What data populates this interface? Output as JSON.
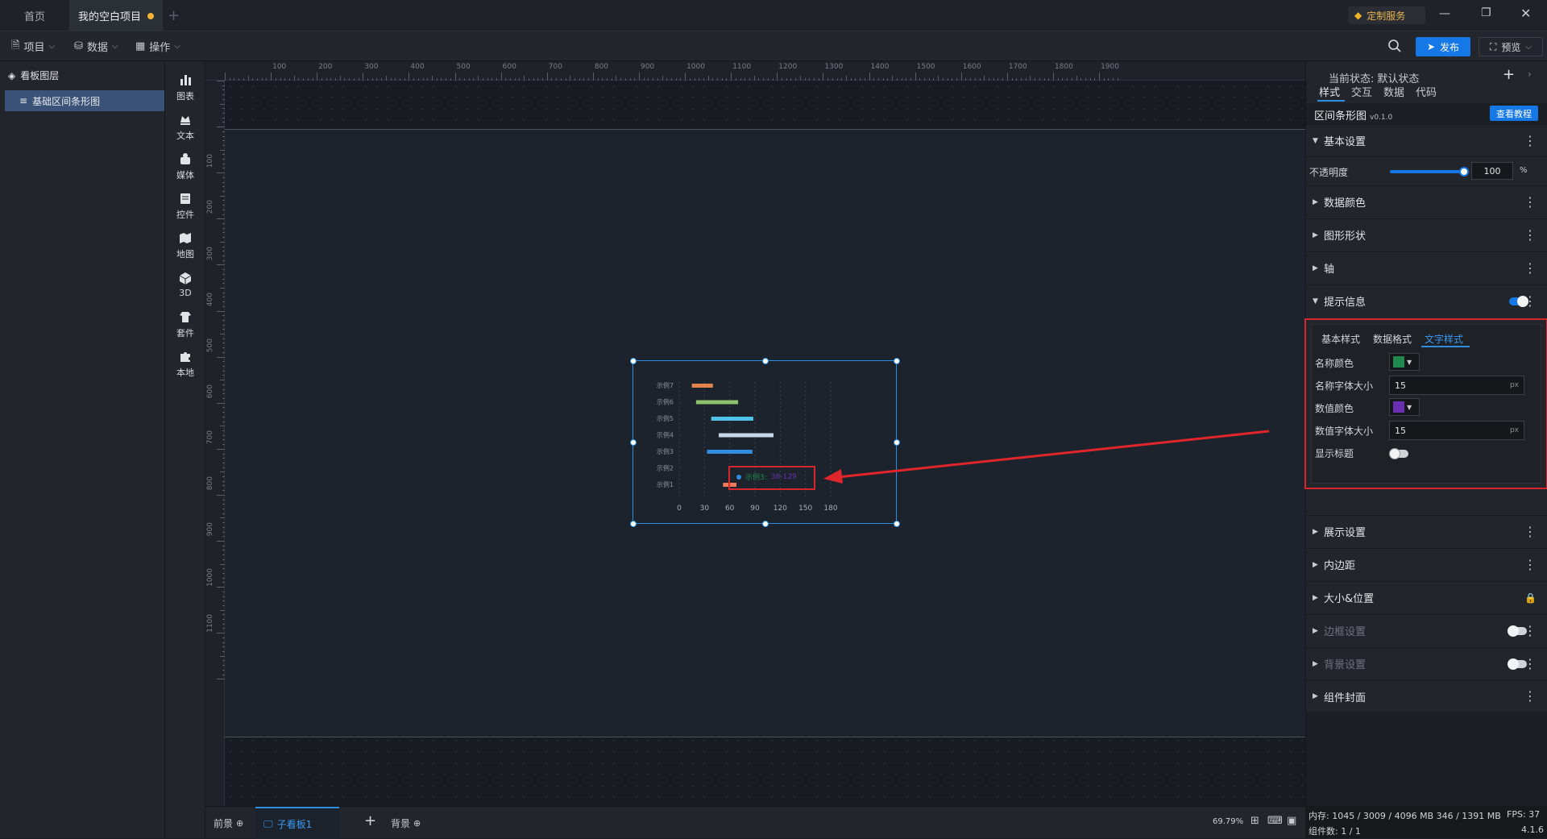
{
  "tabs": {
    "home": "首页",
    "project": "我的空白项目"
  },
  "window": {
    "custom_service": "定制服务"
  },
  "toolbar": {
    "project": "项目",
    "data": "数据",
    "operation": "操作",
    "publish": "发布",
    "preview": "预览"
  },
  "layers": {
    "title": "看板图层",
    "item": "基础区间条形图"
  },
  "components": [
    {
      "label": "图表",
      "icon": "chart-icon"
    },
    {
      "label": "文本",
      "icon": "text-icon"
    },
    {
      "label": "媒体",
      "icon": "media-icon"
    },
    {
      "label": "控件",
      "icon": "control-icon"
    },
    {
      "label": "地图",
      "icon": "map-icon"
    },
    {
      "label": "3D",
      "icon": "cube-icon"
    },
    {
      "label": "套件",
      "icon": "kit-icon"
    },
    {
      "label": "本地",
      "icon": "puzzle-icon"
    }
  ],
  "ruler": {
    "top": [
      "100",
      "200",
      "300",
      "400",
      "500",
      "600",
      "700",
      "800",
      "900",
      "1000",
      "1100",
      "1200",
      "1300",
      "1400",
      "1500",
      "1600",
      "1700",
      "1800",
      "1900"
    ],
    "left": [
      "100",
      "200",
      "300",
      "400",
      "500",
      "600",
      "700",
      "800",
      "900",
      "1000",
      "1100"
    ]
  },
  "chart_data": {
    "type": "bar",
    "categories": [
      "示例7",
      "示例6",
      "示例5",
      "示例4",
      "示例3",
      "示例2",
      "示例1"
    ],
    "ranges": [
      [
        15,
        40
      ],
      [
        20,
        70
      ],
      [
        38,
        88
      ],
      [
        47,
        112
      ],
      [
        33,
        87
      ],
      [
        null,
        null
      ],
      [
        52,
        68
      ]
    ],
    "colors": [
      "#e2834a",
      "#8ec26b",
      "#4fc3e8",
      "#c9d7ea",
      "#2f8ee0",
      "#3f7fd8",
      "#ee7a5c"
    ],
    "xticks": [
      "0",
      "30",
      "60",
      "90",
      "120",
      "150",
      "180"
    ],
    "xlim": [
      0,
      180
    ],
    "tooltip": {
      "name": "示例3:",
      "value": "38-129"
    }
  },
  "bottom": {
    "foreground": "前景",
    "subboard": "子看板1",
    "background": "背景",
    "zoom": "69.79%"
  },
  "right": {
    "state_label": "当前状态:",
    "state_value": "默认状态",
    "tabs": [
      "样式",
      "交互",
      "数据",
      "代码"
    ],
    "component_name": "区间条形图",
    "version": "v0.1.0",
    "tutorial": "查看教程",
    "sections": {
      "basic": "基本设置",
      "opacity": "不透明度",
      "opacity_value": "100",
      "opacity_unit": "%",
      "opacity_level": 1.0,
      "data_color": "数据颜色",
      "shape": "图形形状",
      "axis": "轴",
      "tooltip": "提示信息",
      "display": "展示设置",
      "padding": "内边距",
      "size_pos": "大小&位置",
      "border": "边框设置",
      "bg": "背景设置",
      "cover": "组件封面"
    },
    "tooltip_panel": {
      "tabs": [
        "基本样式",
        "数据格式",
        "文字样式"
      ],
      "name_color": "名称颜色",
      "name_color_hex": "#1f8a4c",
      "name_font": "名称字体大小",
      "name_font_value": "15",
      "value_color": "数值颜色",
      "value_color_hex": "#6a2fb0",
      "value_font": "数值字体大小",
      "value_font_value": "15",
      "unit": "px",
      "show_title": "显示标题"
    }
  },
  "status": {
    "memory": "内存: 1045 / 3009 / 4096 MB 346 / 1391 MB",
    "fps": "FPS: 37",
    "components": "组件数: 1 / 1",
    "version": "4.1.6"
  }
}
